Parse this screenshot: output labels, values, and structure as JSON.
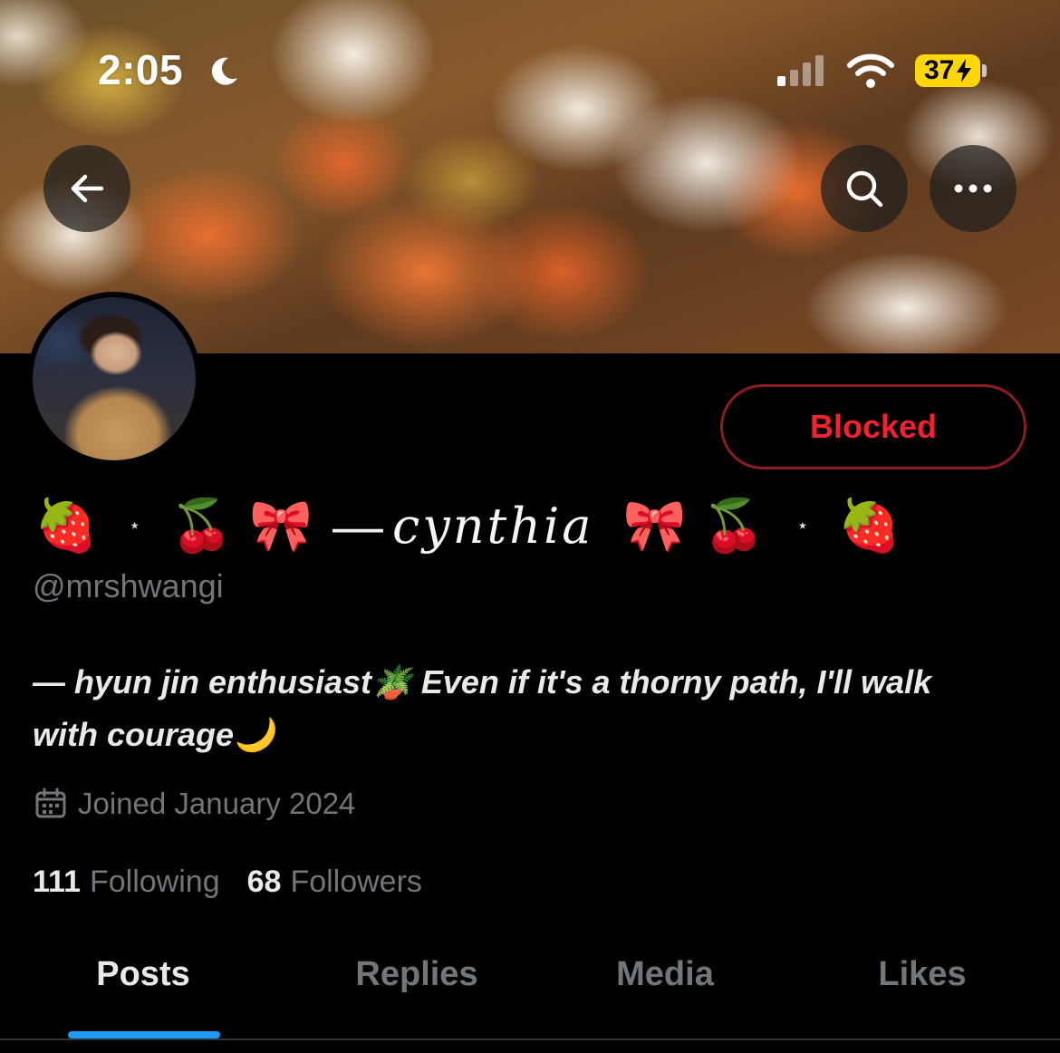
{
  "status_bar": {
    "time": "2:05",
    "battery_level": "37"
  },
  "profile": {
    "display_name_emoji": {
      "strawberry": "🍓",
      "cherries": "🍒",
      "ribbon": "🎀",
      "star": "⋆"
    },
    "display_name_dash": "—",
    "display_name_text": "cynthia",
    "handle": "@mrshwangi",
    "bio_line_1": "— hyun jin enthusiast🪴  Even if it's a thorny path, I'll walk",
    "bio_line_2": "with courage🌙",
    "joined": "Joined January 2024",
    "following_count": "111",
    "following_label": "Following",
    "followers_count": "68",
    "followers_label": "Followers",
    "block_button_label": "Blocked"
  },
  "tabs": [
    {
      "label": "Posts",
      "active": true
    },
    {
      "label": "Replies",
      "active": false
    },
    {
      "label": "Media",
      "active": false
    },
    {
      "label": "Likes",
      "active": false
    }
  ],
  "colors": {
    "background": "#000000",
    "text_primary": "#e7e9ea",
    "text_secondary": "#71767b",
    "blocked_red": "#f4212e",
    "blocked_border": "#8b1d22",
    "tab_indicator": "#1d9bf0",
    "battery_yellow": "#ffd60a"
  },
  "icons": {
    "back": "arrow-left-icon",
    "search": "search-icon",
    "more": "more-horizontal-icon",
    "calendar": "calendar-icon",
    "moon": "moon-icon",
    "signal": "cellular-signal-icon",
    "wifi": "wifi-icon",
    "battery_bolt": "charging-bolt-icon"
  }
}
